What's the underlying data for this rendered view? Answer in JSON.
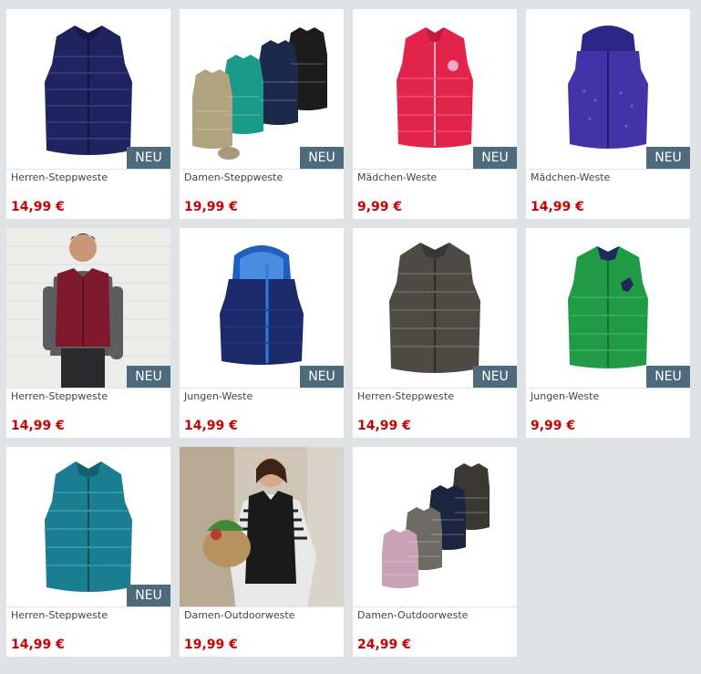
{
  "products": [
    {
      "title": "Herren-Steppweste",
      "price": "14,99 €",
      "badge": "NEU",
      "image": "navy-vest-image",
      "color": "#1f2461"
    },
    {
      "title": "Damen-Steppweste",
      "price": "19,99 €",
      "badge": "NEU",
      "image": "four-vests-image",
      "color": "#1a9a8a"
    },
    {
      "title": "Mädchen-Weste",
      "price": "9,99 €",
      "badge": "NEU",
      "image": "pink-vest-image",
      "color": "#e2234a"
    },
    {
      "title": "Mädchen-Weste",
      "price": "14,99 €",
      "badge": "NEU",
      "image": "purple-hooded-vest-image",
      "color": "#4233a8"
    },
    {
      "title": "Herren-Steppweste",
      "price": "14,99 €",
      "badge": "NEU",
      "image": "man-wearing-red-vest-image",
      "color": "#7e1a2c"
    },
    {
      "title": "Jungen-Weste",
      "price": "14,99 €",
      "badge": "NEU",
      "image": "boys-blue-hooded-vest-image",
      "color": "#1b2a6b"
    },
    {
      "title": "Herren-Steppweste",
      "price": "14,99 €",
      "badge": "NEU",
      "image": "grey-vest-image",
      "color": "#4d4a45"
    },
    {
      "title": "Jungen-Weste",
      "price": "9,99 €",
      "badge": "NEU",
      "image": "green-vest-image",
      "color": "#1f9a45"
    },
    {
      "title": "Herren-Steppweste",
      "price": "14,99 €",
      "badge": "NEU",
      "image": "teal-vest-image",
      "color": "#1a7d92"
    },
    {
      "title": "Damen-Outdoorweste",
      "price": "19,99 €",
      "badge": "",
      "image": "woman-wearing-black-vest-image",
      "color": "#1a1a1a"
    },
    {
      "title": "Damen-Outdoorweste",
      "price": "24,99 €",
      "badge": "",
      "image": "outdoor-vests-image",
      "color": "#5a5248"
    }
  ]
}
